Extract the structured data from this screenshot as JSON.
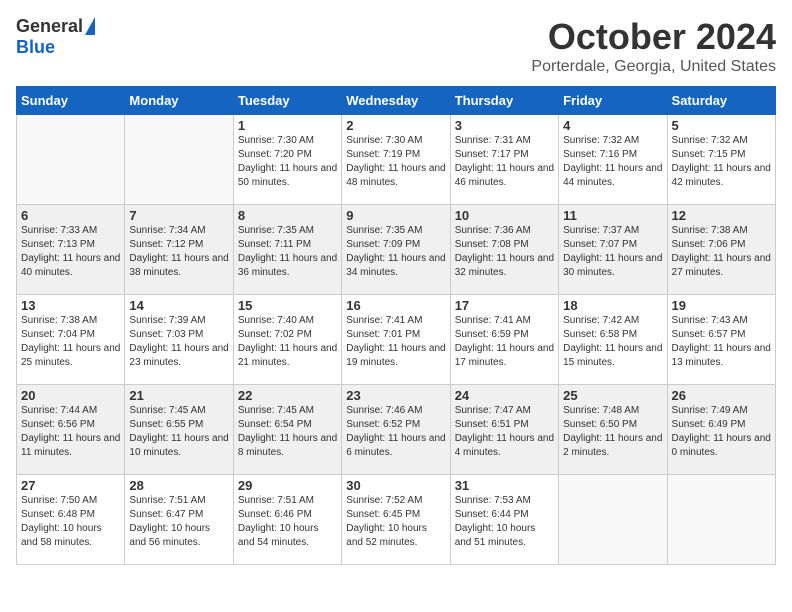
{
  "logo": {
    "general": "General",
    "blue": "Blue"
  },
  "title": {
    "month": "October 2024",
    "location": "Porterdale, Georgia, United States"
  },
  "weekdays": [
    "Sunday",
    "Monday",
    "Tuesday",
    "Wednesday",
    "Thursday",
    "Friday",
    "Saturday"
  ],
  "weeks": [
    [
      {
        "day": "",
        "sunrise": "",
        "sunset": "",
        "daylight": ""
      },
      {
        "day": "",
        "sunrise": "",
        "sunset": "",
        "daylight": ""
      },
      {
        "day": "1",
        "sunrise": "Sunrise: 7:30 AM",
        "sunset": "Sunset: 7:20 PM",
        "daylight": "Daylight: 11 hours and 50 minutes."
      },
      {
        "day": "2",
        "sunrise": "Sunrise: 7:30 AM",
        "sunset": "Sunset: 7:19 PM",
        "daylight": "Daylight: 11 hours and 48 minutes."
      },
      {
        "day": "3",
        "sunrise": "Sunrise: 7:31 AM",
        "sunset": "Sunset: 7:17 PM",
        "daylight": "Daylight: 11 hours and 46 minutes."
      },
      {
        "day": "4",
        "sunrise": "Sunrise: 7:32 AM",
        "sunset": "Sunset: 7:16 PM",
        "daylight": "Daylight: 11 hours and 44 minutes."
      },
      {
        "day": "5",
        "sunrise": "Sunrise: 7:32 AM",
        "sunset": "Sunset: 7:15 PM",
        "daylight": "Daylight: 11 hours and 42 minutes."
      }
    ],
    [
      {
        "day": "6",
        "sunrise": "Sunrise: 7:33 AM",
        "sunset": "Sunset: 7:13 PM",
        "daylight": "Daylight: 11 hours and 40 minutes."
      },
      {
        "day": "7",
        "sunrise": "Sunrise: 7:34 AM",
        "sunset": "Sunset: 7:12 PM",
        "daylight": "Daylight: 11 hours and 38 minutes."
      },
      {
        "day": "8",
        "sunrise": "Sunrise: 7:35 AM",
        "sunset": "Sunset: 7:11 PM",
        "daylight": "Daylight: 11 hours and 36 minutes."
      },
      {
        "day": "9",
        "sunrise": "Sunrise: 7:35 AM",
        "sunset": "Sunset: 7:09 PM",
        "daylight": "Daylight: 11 hours and 34 minutes."
      },
      {
        "day": "10",
        "sunrise": "Sunrise: 7:36 AM",
        "sunset": "Sunset: 7:08 PM",
        "daylight": "Daylight: 11 hours and 32 minutes."
      },
      {
        "day": "11",
        "sunrise": "Sunrise: 7:37 AM",
        "sunset": "Sunset: 7:07 PM",
        "daylight": "Daylight: 11 hours and 30 minutes."
      },
      {
        "day": "12",
        "sunrise": "Sunrise: 7:38 AM",
        "sunset": "Sunset: 7:06 PM",
        "daylight": "Daylight: 11 hours and 27 minutes."
      }
    ],
    [
      {
        "day": "13",
        "sunrise": "Sunrise: 7:38 AM",
        "sunset": "Sunset: 7:04 PM",
        "daylight": "Daylight: 11 hours and 25 minutes."
      },
      {
        "day": "14",
        "sunrise": "Sunrise: 7:39 AM",
        "sunset": "Sunset: 7:03 PM",
        "daylight": "Daylight: 11 hours and 23 minutes."
      },
      {
        "day": "15",
        "sunrise": "Sunrise: 7:40 AM",
        "sunset": "Sunset: 7:02 PM",
        "daylight": "Daylight: 11 hours and 21 minutes."
      },
      {
        "day": "16",
        "sunrise": "Sunrise: 7:41 AM",
        "sunset": "Sunset: 7:01 PM",
        "daylight": "Daylight: 11 hours and 19 minutes."
      },
      {
        "day": "17",
        "sunrise": "Sunrise: 7:41 AM",
        "sunset": "Sunset: 6:59 PM",
        "daylight": "Daylight: 11 hours and 17 minutes."
      },
      {
        "day": "18",
        "sunrise": "Sunrise: 7:42 AM",
        "sunset": "Sunset: 6:58 PM",
        "daylight": "Daylight: 11 hours and 15 minutes."
      },
      {
        "day": "19",
        "sunrise": "Sunrise: 7:43 AM",
        "sunset": "Sunset: 6:57 PM",
        "daylight": "Daylight: 11 hours and 13 minutes."
      }
    ],
    [
      {
        "day": "20",
        "sunrise": "Sunrise: 7:44 AM",
        "sunset": "Sunset: 6:56 PM",
        "daylight": "Daylight: 11 hours and 11 minutes."
      },
      {
        "day": "21",
        "sunrise": "Sunrise: 7:45 AM",
        "sunset": "Sunset: 6:55 PM",
        "daylight": "Daylight: 11 hours and 10 minutes."
      },
      {
        "day": "22",
        "sunrise": "Sunrise: 7:45 AM",
        "sunset": "Sunset: 6:54 PM",
        "daylight": "Daylight: 11 hours and 8 minutes."
      },
      {
        "day": "23",
        "sunrise": "Sunrise: 7:46 AM",
        "sunset": "Sunset: 6:52 PM",
        "daylight": "Daylight: 11 hours and 6 minutes."
      },
      {
        "day": "24",
        "sunrise": "Sunrise: 7:47 AM",
        "sunset": "Sunset: 6:51 PM",
        "daylight": "Daylight: 11 hours and 4 minutes."
      },
      {
        "day": "25",
        "sunrise": "Sunrise: 7:48 AM",
        "sunset": "Sunset: 6:50 PM",
        "daylight": "Daylight: 11 hours and 2 minutes."
      },
      {
        "day": "26",
        "sunrise": "Sunrise: 7:49 AM",
        "sunset": "Sunset: 6:49 PM",
        "daylight": "Daylight: 11 hours and 0 minutes."
      }
    ],
    [
      {
        "day": "27",
        "sunrise": "Sunrise: 7:50 AM",
        "sunset": "Sunset: 6:48 PM",
        "daylight": "Daylight: 10 hours and 58 minutes."
      },
      {
        "day": "28",
        "sunrise": "Sunrise: 7:51 AM",
        "sunset": "Sunset: 6:47 PM",
        "daylight": "Daylight: 10 hours and 56 minutes."
      },
      {
        "day": "29",
        "sunrise": "Sunrise: 7:51 AM",
        "sunset": "Sunset: 6:46 PM",
        "daylight": "Daylight: 10 hours and 54 minutes."
      },
      {
        "day": "30",
        "sunrise": "Sunrise: 7:52 AM",
        "sunset": "Sunset: 6:45 PM",
        "daylight": "Daylight: 10 hours and 52 minutes."
      },
      {
        "day": "31",
        "sunrise": "Sunrise: 7:53 AM",
        "sunset": "Sunset: 6:44 PM",
        "daylight": "Daylight: 10 hours and 51 minutes."
      },
      {
        "day": "",
        "sunrise": "",
        "sunset": "",
        "daylight": ""
      },
      {
        "day": "",
        "sunrise": "",
        "sunset": "",
        "daylight": ""
      }
    ]
  ]
}
